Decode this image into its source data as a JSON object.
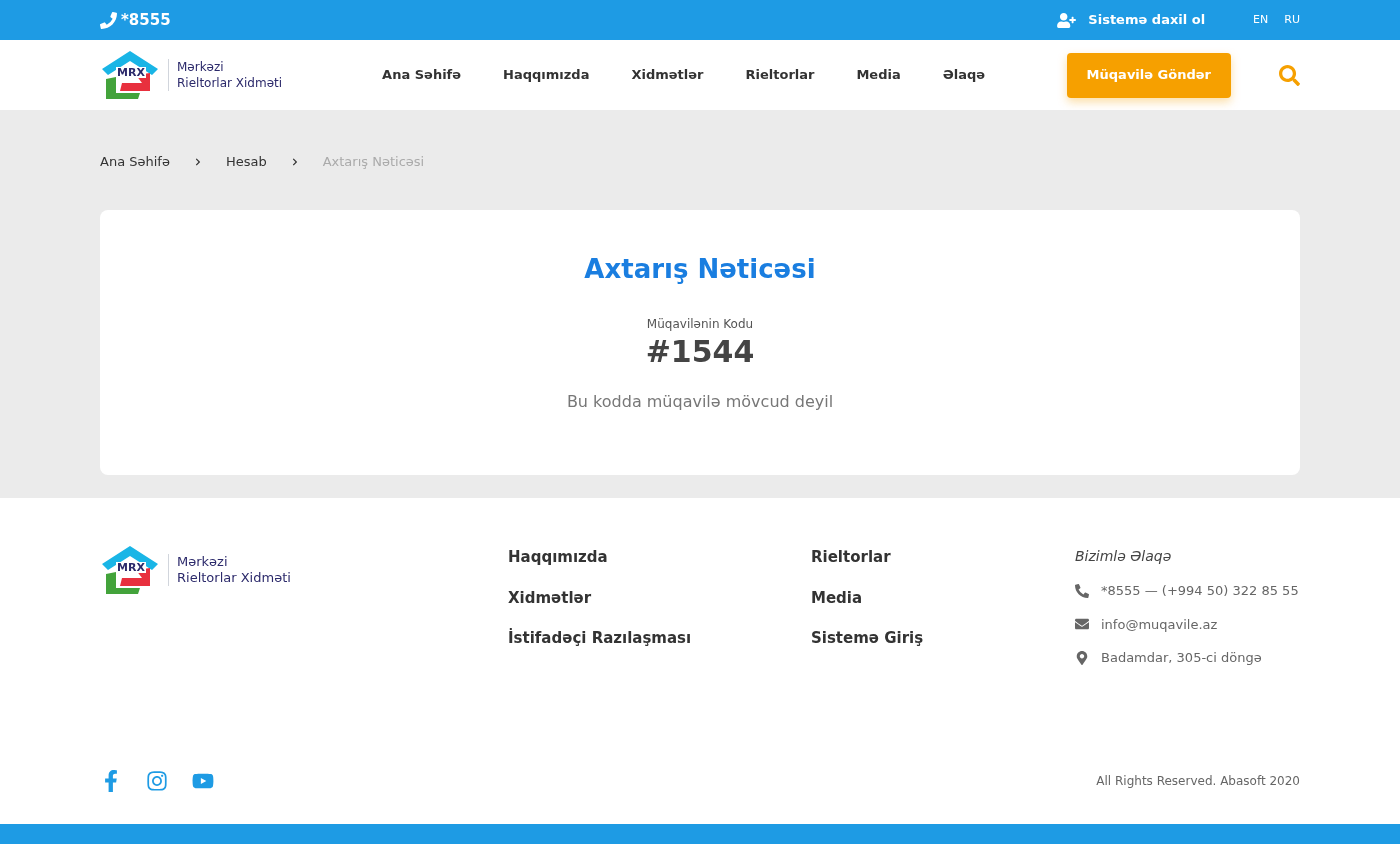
{
  "top_bar": {
    "phone": "*8555",
    "login": "Sistemə daxil ol",
    "languages": [
      {
        "label": "EN"
      },
      {
        "label": "RU"
      }
    ]
  },
  "header": {
    "logo": {
      "mark": "MRX",
      "line1": "Mərkəzi",
      "line2": "Rieltorlar Xidməti"
    },
    "nav": [
      "Ana Səhifə",
      "Haqqımızda",
      "Xidmətlər",
      "Rieltorlar",
      "Media",
      "Əlaqə"
    ],
    "cta": "Müqavilə Göndər"
  },
  "breadcrumbs": [
    {
      "label": "Ana Səhifə",
      "current": false
    },
    {
      "label": "Hesab",
      "current": false
    },
    {
      "label": "Axtarış Nəticəsi",
      "current": true
    }
  ],
  "result": {
    "title": "Axtarış Nəticəsi",
    "code_label": "Müqavilənin Kodu",
    "code": "#1544",
    "message": "Bu kodda müqavilə mövcud deyil"
  },
  "footer": {
    "logo": {
      "mark": "MRX",
      "line1": "Mərkəzi",
      "line2": "Rieltorlar Xidməti"
    },
    "link_columns": [
      [
        "Haqqımızda",
        "Xidmətlər",
        "İstifadəçi Razılaşması"
      ],
      [
        "Rieltorlar",
        "Media",
        "Sistemə Giriş"
      ]
    ],
    "contact_title": "Bizimlə Əlaqə",
    "contacts": [
      {
        "kind": "phone",
        "text": "*8555 — (+994 50) 322 85 55"
      },
      {
        "kind": "email",
        "text": "info@muqavile.az"
      },
      {
        "kind": "address",
        "text": "Badamdar, 305-ci döngə"
      }
    ],
    "social": [
      {
        "kind": "facebook"
      },
      {
        "kind": "instagram"
      },
      {
        "kind": "youtube"
      }
    ],
    "copyright": "All Rights Reserved. Abasoft 2020"
  }
}
